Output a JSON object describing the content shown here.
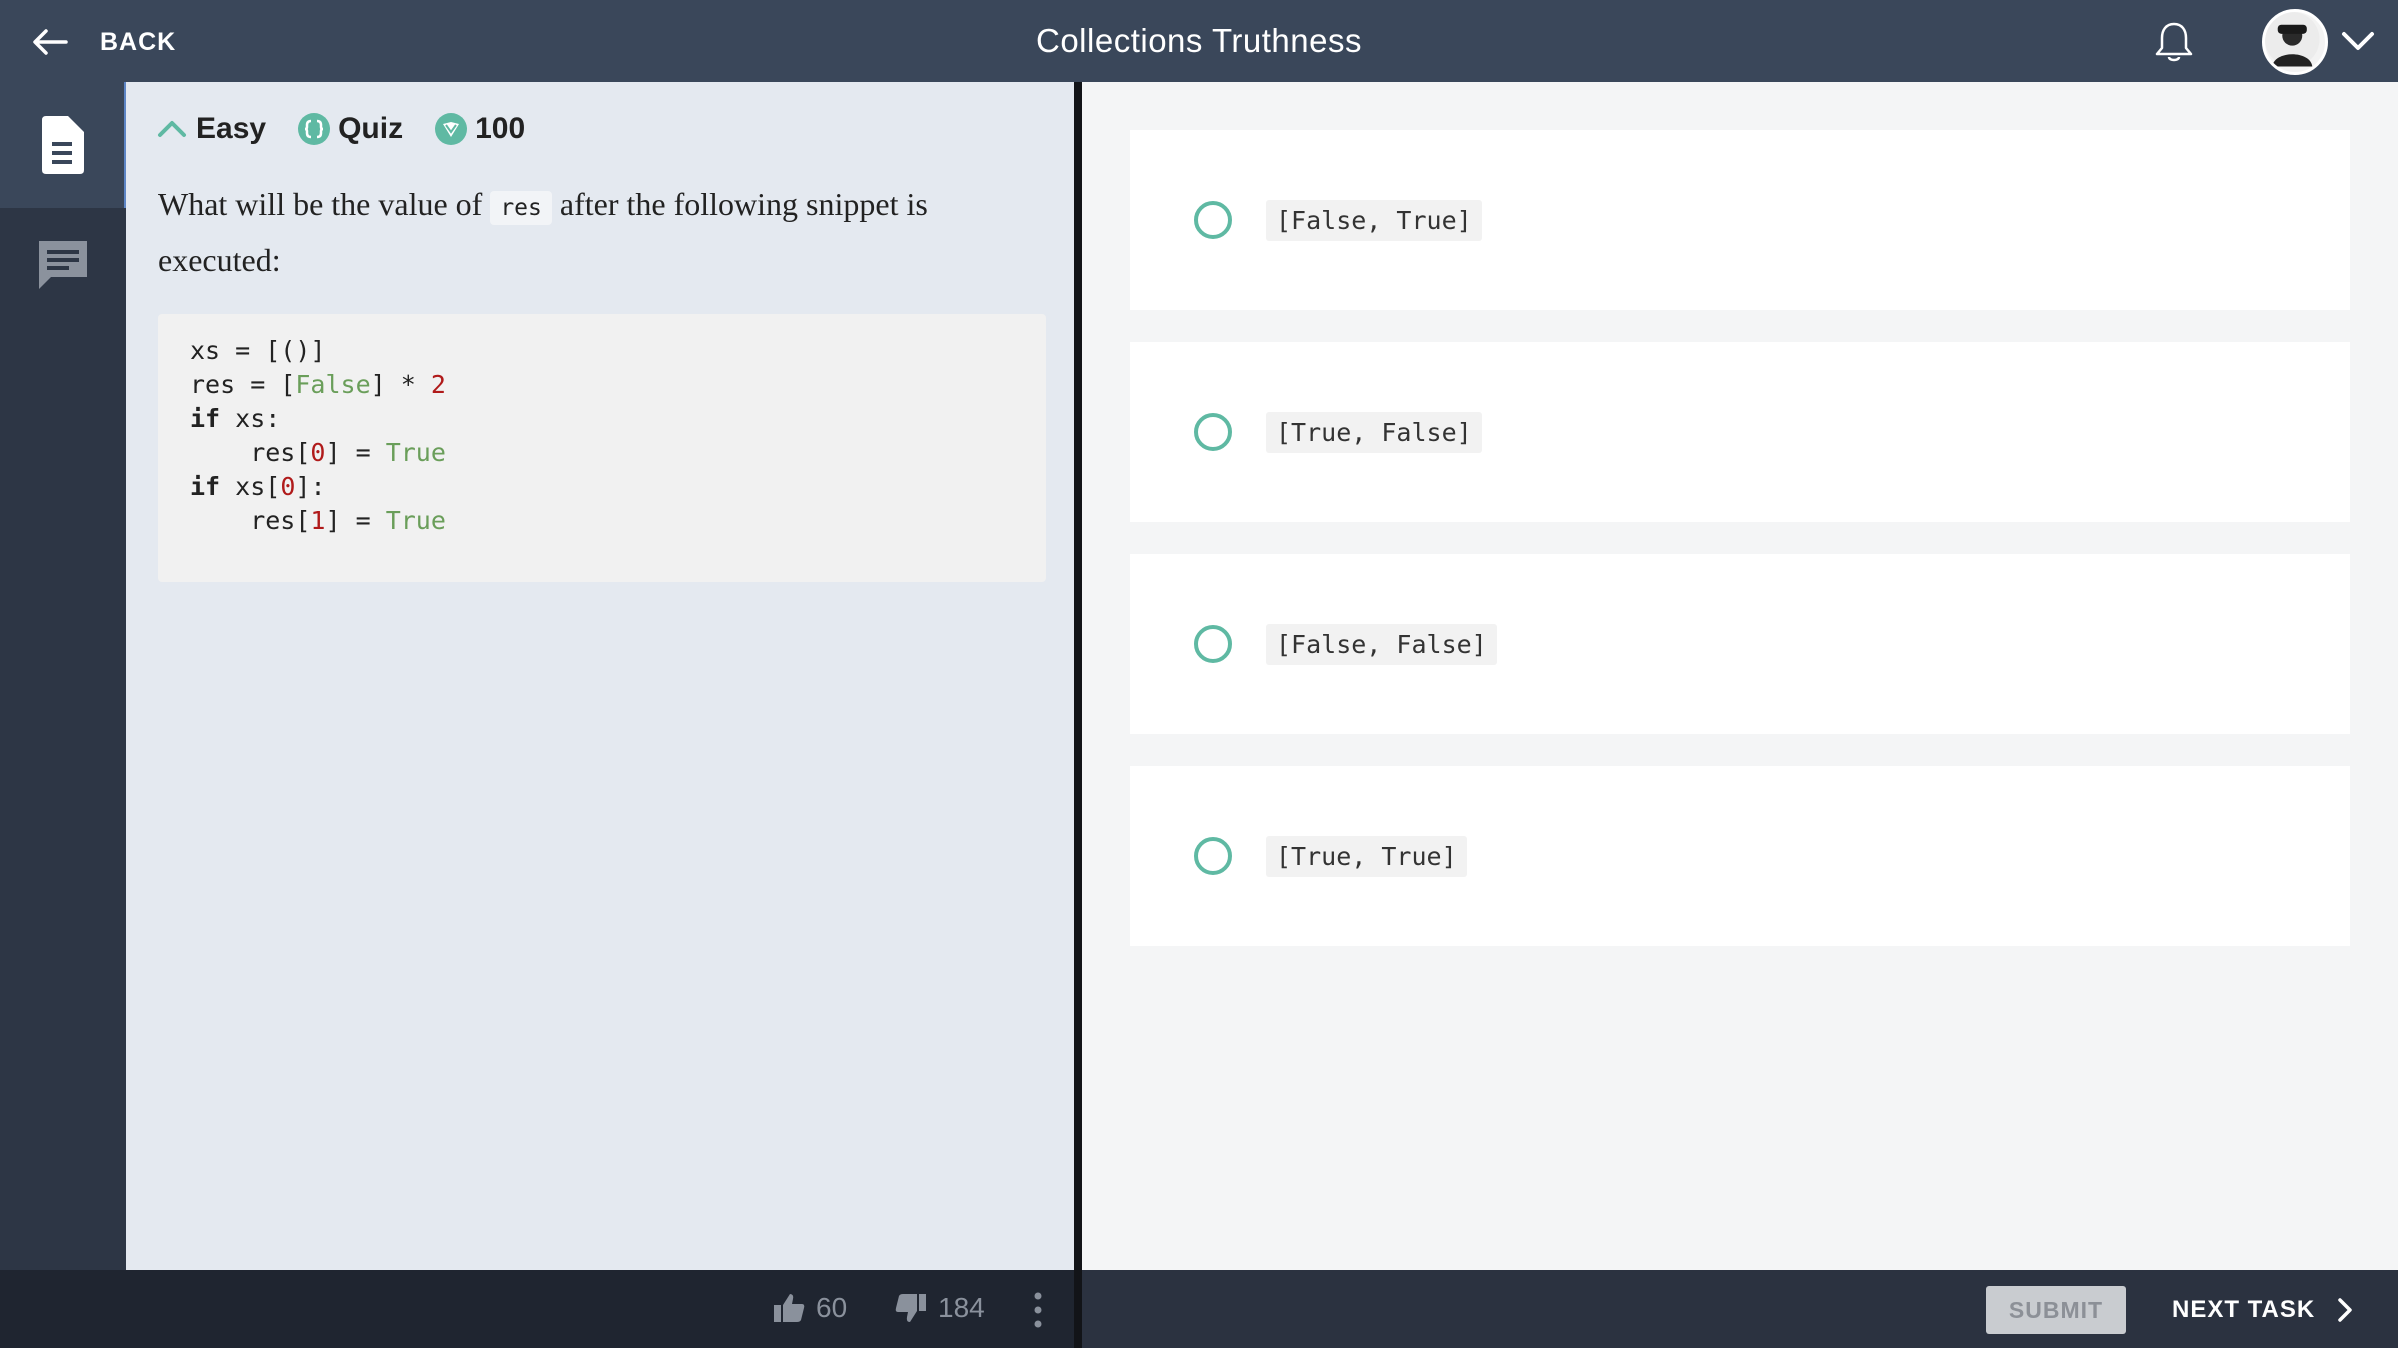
{
  "header": {
    "back_label": "BACK",
    "title": "Collections Truthness",
    "icons": [
      "arrow-left-icon",
      "bell-icon",
      "avatar",
      "chevron-down-icon"
    ]
  },
  "sidebar": {
    "items": [
      {
        "icon": "document-icon",
        "active": true
      },
      {
        "icon": "chat-icon",
        "active": false
      }
    ]
  },
  "task": {
    "difficulty": "Easy",
    "type": "Quiz",
    "points": "100",
    "question_before": "What will be the value of",
    "question_code": "res",
    "question_after": "after the following snippet is executed:",
    "code": {
      "line1": "xs = [()]",
      "line2_a": "res = [",
      "line2_false": "False",
      "line2_b": "] * ",
      "line2_num": "2",
      "line3_kw": "if",
      "line3_rest": " xs:",
      "line4_a": "    res[",
      "line4_idx": "0",
      "line4_b": "] = ",
      "line4_true": "True",
      "line5_kw": "if",
      "line5_a": " xs[",
      "line5_idx": "0",
      "line5_b": "]:",
      "line6_a": "    res[",
      "line6_idx": "1",
      "line6_b": "] = ",
      "line6_true": "True"
    }
  },
  "options": [
    {
      "label": "[False, True]"
    },
    {
      "label": "[True, False]"
    },
    {
      "label": "[False, False]"
    },
    {
      "label": "[True, True]"
    }
  ],
  "footer": {
    "likes": "60",
    "dislikes": "184",
    "submit_label": "SUBMIT",
    "next_label": "NEXT TASK"
  },
  "colors": {
    "accent": "#5fb9a3",
    "topbar": "#3a475a",
    "sidebar": "#2d3645"
  }
}
